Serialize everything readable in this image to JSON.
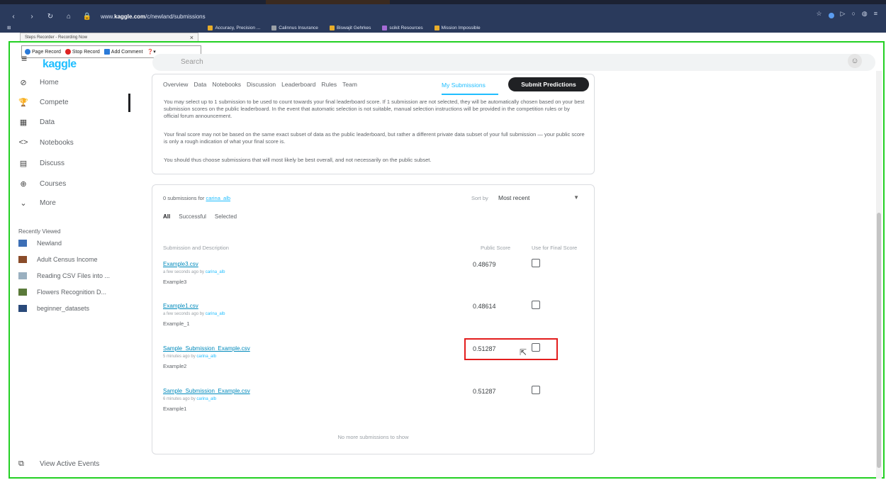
{
  "browser": {
    "url_prefix": "www.",
    "url_domain": "kaggle.com",
    "url_path": "/c/newland/submissions",
    "bookmarks": [
      {
        "label": "Accuracy, Precision ...",
        "color": "#e8ad2a"
      },
      {
        "label": "Calinnus Insurance",
        "color": "#9aa0a6"
      },
      {
        "label": "Biswajit Gehrkes",
        "color": "#e8ad2a"
      },
      {
        "label": "scikit Resources",
        "color": "#a56bd6"
      },
      {
        "label": "Mission Impossible",
        "color": "#e8ad2a"
      }
    ]
  },
  "recorder": {
    "popup_text": "Steps Recorder - Recording Now",
    "page_record": "Page Record",
    "stop_record": "Stop Record",
    "add_comment": "Add Comment"
  },
  "header": {
    "logo": "kaggle",
    "search_placeholder": "Search"
  },
  "sidebar": {
    "items": [
      {
        "label": "Home",
        "icon": "⊘"
      },
      {
        "label": "Compete",
        "icon": "🏆"
      },
      {
        "label": "Data",
        "icon": "▦"
      },
      {
        "label": "Notebooks",
        "icon": "<>"
      },
      {
        "label": "Discuss",
        "icon": "▤"
      },
      {
        "label": "Courses",
        "icon": "⊕"
      },
      {
        "label": "More",
        "icon": "⌄"
      }
    ],
    "recent_title": "Recently Viewed",
    "recent": [
      {
        "label": "Newland",
        "color": "#3d6fb6"
      },
      {
        "label": "Adult Census Income",
        "color": "#8a4c2a"
      },
      {
        "label": "Reading CSV Files into ...",
        "color": "#9ab0c0"
      },
      {
        "label": "Flowers Recognition D...",
        "color": "#5a7a3a"
      },
      {
        "label": "beginner_datasets",
        "color": "#2a4a7a"
      }
    ],
    "view_events": "View Active Events"
  },
  "tabs": {
    "items": [
      "Overview",
      "Data",
      "Notebooks",
      "Discussion",
      "Leaderboard",
      "Rules",
      "Team"
    ],
    "active": "My Submissions",
    "submit": "Submit Predictions"
  },
  "info": {
    "p1": "You may select up to 1 submission to be used to count towards your final leaderboard score. If 1 submission are not selected, they will be automatically chosen based on your best submission scores on the public leaderboard. In the event that automatic selection is not suitable, manual selection instructions will be provided in the competition rules or by official forum announcement.",
    "p2": "Your final score may not be based on the same exact subset of data as the public leaderboard, but rather a different private data subset of your full submission — your public score is only a rough indication of what your final score is.",
    "p3": "You should thus choose submissions that will most likely be best overall, and not necessarily on the public subset."
  },
  "submissions": {
    "count_text": "0 submissions for ",
    "count_user": "carina_alb",
    "sort_label": "Sort by",
    "sort_value": "Most recent",
    "filters": [
      "All",
      "Successful",
      "Selected"
    ],
    "col_desc": "Submission and Description",
    "col_score": "Public Score",
    "col_final": "Use for Final Score",
    "rows": [
      {
        "file": "Example3.csv",
        "meta": "a few seconds ago by ",
        "user": "carina_alb",
        "desc": "Example3",
        "score": "0.48679"
      },
      {
        "file": "Example1.csv",
        "meta": "a few seconds ago by ",
        "user": "carina_alb",
        "desc": "Example_1",
        "score": "0.48614"
      },
      {
        "file": "Sample_Submission_Example.csv",
        "meta": "5 minutes ago by ",
        "user": "carina_alb",
        "desc": "Example2",
        "score": "0.51287"
      },
      {
        "file": "Sample_Submission_Example.csv",
        "meta": "6 minutes ago by ",
        "user": "carina_alb",
        "desc": "Example1",
        "score": "0.51287"
      }
    ],
    "no_more": "No more submissions to show"
  }
}
